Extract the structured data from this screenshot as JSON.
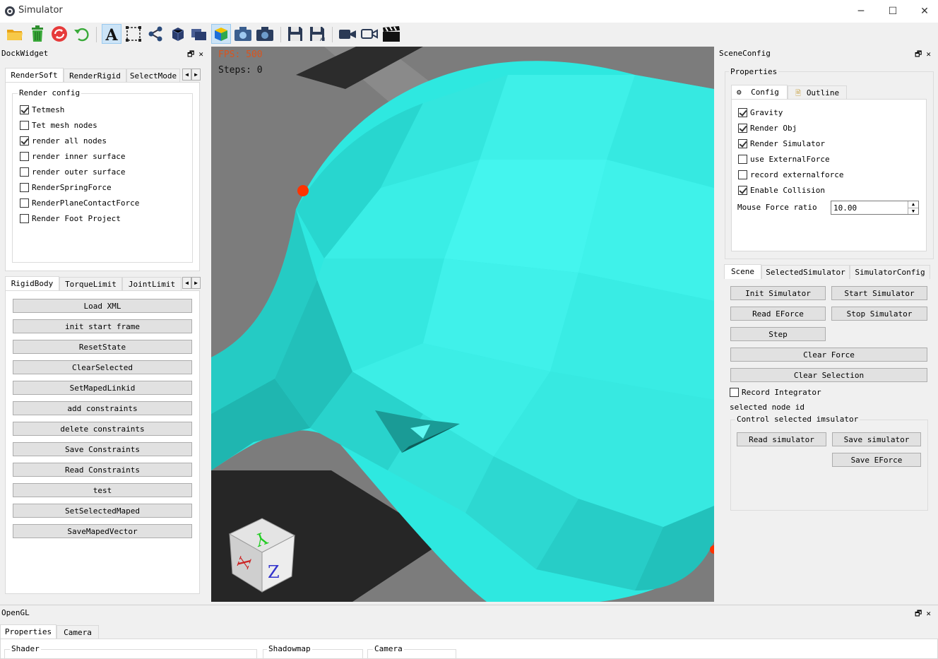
{
  "window": {
    "title": "Simulator",
    "minimize": "─",
    "maximize": "☐",
    "close": "✕"
  },
  "toolbar": {
    "icons": [
      "folder-open-icon",
      "trash-icon",
      "refresh-icon",
      "undo-icon",
      "text-tool-icon",
      "select-rect-icon",
      "share-graph-icon",
      "cube-solid-icon",
      "cube-layers-icon",
      "cube-color-icon",
      "camera-icon",
      "camera-snapshot-icon",
      "save-icon",
      "save-all-icon",
      "video-camera-icon",
      "video-outline-icon",
      "clapperboard-icon"
    ]
  },
  "left_dock": {
    "title": "DockWidget",
    "top_tabs": [
      "RenderSoft",
      "RenderRigid",
      "SelectMode"
    ],
    "render_config": {
      "title": "Render config",
      "items": [
        {
          "label": "Tetmesh",
          "checked": true
        },
        {
          "label": "Tet mesh nodes",
          "checked": false
        },
        {
          "label": "render all nodes",
          "checked": true
        },
        {
          "label": "render inner surface",
          "checked": false
        },
        {
          "label": "render outer surface",
          "checked": false
        },
        {
          "label": "RenderSpringForce",
          "checked": false
        },
        {
          "label": "RenderPlaneContactForce",
          "checked": false
        },
        {
          "label": "Render Foot Project",
          "checked": false
        }
      ]
    },
    "bottom_tabs": [
      "RigidBody",
      "TorqueLimit",
      "JointLimit"
    ],
    "buttons": [
      "Load XML",
      "init start frame",
      "ResetState",
      "ClearSelected",
      "SetMapedLinkid",
      "add constraints",
      "delete constraints",
      "Save Constraints",
      "Read Constraints",
      "test",
      "SetSelectedMaped",
      "SaveMapedVector"
    ]
  },
  "viewport": {
    "fps_label": "FPS: 500",
    "steps_label": "Steps: 0",
    "axes": {
      "x": "X",
      "y": "Y",
      "z": "Z"
    },
    "colors": {
      "mesh": "#2ee8e0",
      "background": "#7a7a7a",
      "floor_stripe": "#2b2b2b",
      "marker": "#ff3300"
    }
  },
  "right_dock": {
    "title": "SceneConfig",
    "properties_title": "Properties",
    "prop_tabs": [
      "Config",
      "Outline"
    ],
    "config_items": [
      {
        "label": "Gravity",
        "checked": true
      },
      {
        "label": "Render Obj",
        "checked": true
      },
      {
        "label": "Render Simulator",
        "checked": true
      },
      {
        "label": "use ExternalForce",
        "checked": false
      },
      {
        "label": "record externalforce",
        "checked": false
      },
      {
        "label": "Enable Collision",
        "checked": true
      }
    ],
    "mouse_force": {
      "label": "Mouse Force ratio",
      "value": "10.00"
    },
    "scene_tabs": [
      "Scene",
      "SelectedSimulator",
      "SimulatorConfig"
    ],
    "buttons": {
      "init": "Init Simulator",
      "start": "Start Simulator",
      "read_eforce": "Read EForce",
      "stop": "Stop Simulator",
      "step": "Step",
      "clear_force": "Clear Force",
      "clear_selection": "Clear Selection"
    },
    "record_integrator": {
      "label": "Record Integrator",
      "checked": false
    },
    "selected_node_label": "selected node id",
    "control_group": {
      "title": "Control selected imsulator",
      "read": "Read simulator",
      "save": "Save simulator",
      "save_eforce": "Save EForce"
    }
  },
  "bottom_dock": {
    "title": "OpenGL",
    "tabs": [
      "Properties",
      "Camera"
    ],
    "groups": [
      "Shader",
      "Shadowmap",
      "Camera"
    ]
  }
}
